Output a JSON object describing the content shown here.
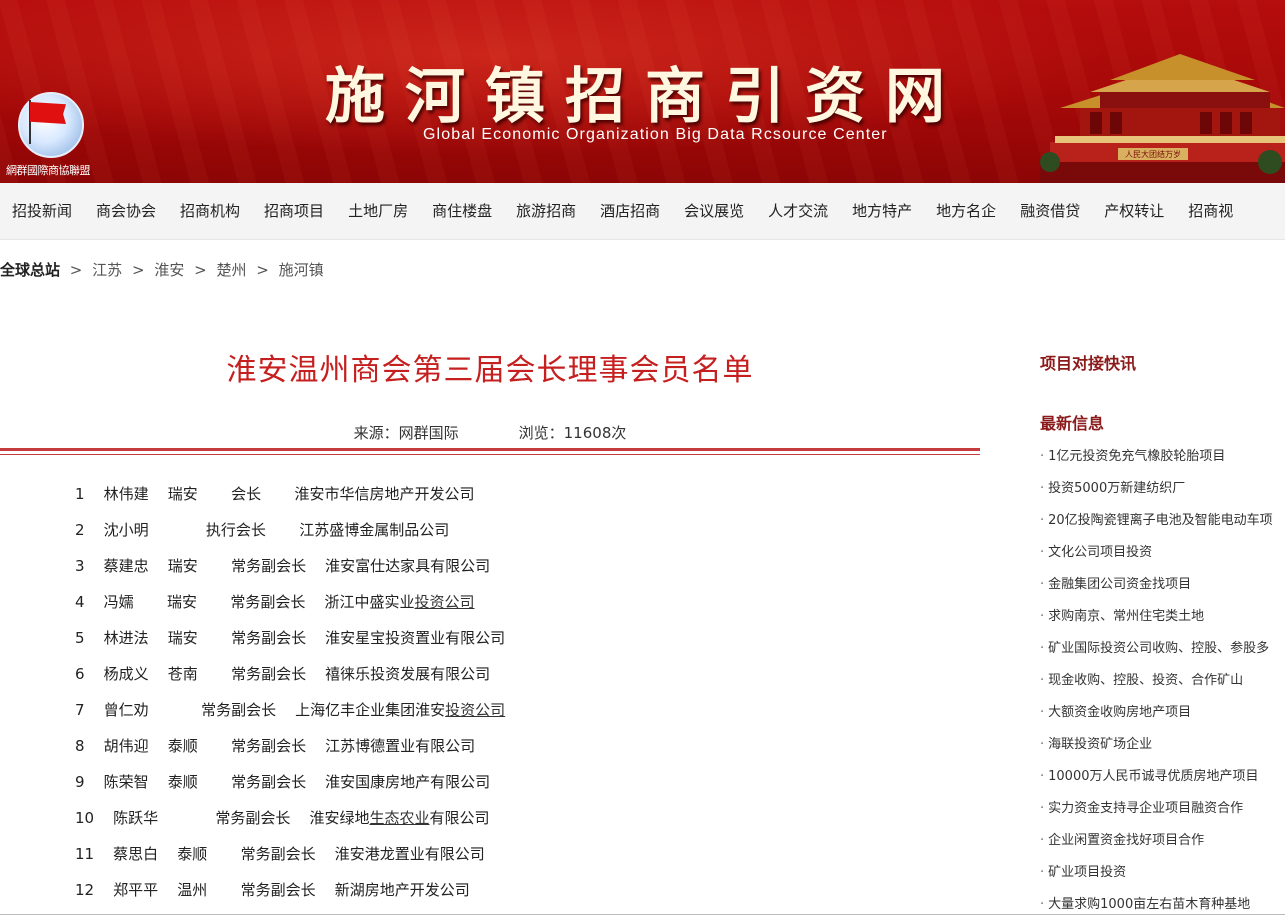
{
  "banner": {
    "title": "施河镇招商引资网",
    "subtitle": "Global Economic Organization Big Data Rcsource Center",
    "logo_text": "網群國際商協聯盟",
    "gate_text": "人民大团结万岁"
  },
  "nav": [
    "招投新闻",
    "商会协会",
    "招商机构",
    "招商项目",
    "土地厂房",
    "商住楼盘",
    "旅游招商",
    "酒店招商",
    "会议展览",
    "人才交流",
    "地方特产",
    "地方名企",
    "融资借贷",
    "产权转让",
    "招商视"
  ],
  "breadcrumb": {
    "root": "全球总站",
    "sep": ">",
    "items": [
      "江苏",
      "淮安",
      "楚州",
      "施河镇"
    ]
  },
  "article": {
    "title": "淮安温州商会第三届会长理事会员名单",
    "source_label": "来源：网群国际",
    "views_label": "浏览：11608次"
  },
  "members": [
    {
      "no": "1",
      "pre": "林伟建    瑞安       会长       淮安市华信房地产开发公司",
      "link": "",
      "post": ""
    },
    {
      "no": "2",
      "pre": "沈小明            执行会长       江苏盛博金属制品公司",
      "link": "",
      "post": ""
    },
    {
      "no": "3",
      "pre": "蔡建忠    瑞安       常务副会长    淮安富仕达家具有限公司",
      "link": "",
      "post": ""
    },
    {
      "no": "4",
      "pre": "冯嬬       瑞安       常务副会长    浙江中盛实业",
      "link": "投资公司",
      "post": ""
    },
    {
      "no": "5",
      "pre": "林进法    瑞安       常务副会长    淮安星宝投资置业有限公司",
      "link": "",
      "post": ""
    },
    {
      "no": "6",
      "pre": "杨成义    苍南       常务副会长    禧徕乐投资发展有限公司",
      "link": "",
      "post": ""
    },
    {
      "no": "7",
      "pre": "曾仁劝           常务副会长    上海亿丰企业集团淮安",
      "link": "投资公司",
      "post": ""
    },
    {
      "no": "8",
      "pre": "胡伟迎    泰顺       常务副会长    江苏博德置业有限公司",
      "link": "",
      "post": ""
    },
    {
      "no": "9",
      "pre": "陈荣智    泰顺       常务副会长    淮安国康房地产有限公司",
      "link": "",
      "post": ""
    },
    {
      "no": "10",
      "pre": "陈跃华            常务副会长    淮安绿地",
      "link": "生态农业",
      "post": "有限公司"
    },
    {
      "no": "11",
      "pre": "蔡思白    泰顺       常务副会长    淮安港龙置业有限公司",
      "link": "",
      "post": ""
    },
    {
      "no": "12",
      "pre": "郑平平    温州       常务副会长    新湖房地产开发公司",
      "link": "",
      "post": ""
    }
  ],
  "sidebar": {
    "heading1": "项目对接快讯",
    "heading2": "最新信息",
    "items": [
      "1亿元投资免充气橡胶轮胎项目",
      "投资5000万新建纺织厂",
      "20亿投陶瓷锂离子电池及智能电动车项",
      "文化公司项目投资",
      "金融集团公司资金找项目",
      "求购南京、常州住宅类土地",
      "矿业国际投资公司收购、控股、参股多",
      "现金收购、控股、投资、合作矿山",
      "大额资金收购房地产项目",
      "海联投资矿场企业",
      "10000万人民币诚寻优质房地产项目",
      "实力资金支持寻企业项目融资合作",
      "企业闲置资金找好项目合作",
      "矿业项目投资",
      "大量求购1000亩左右苗木育种基地"
    ]
  }
}
